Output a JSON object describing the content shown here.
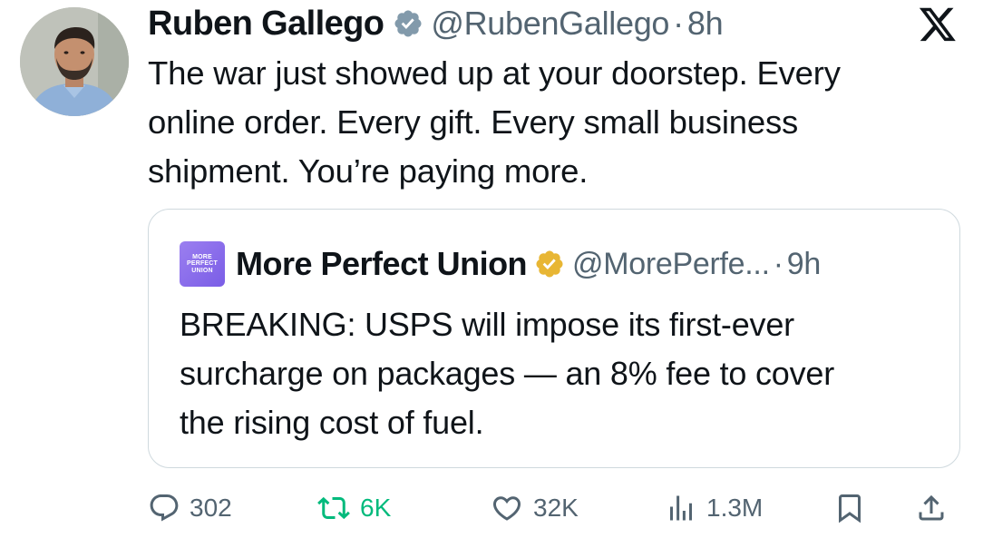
{
  "tweet": {
    "author": {
      "name": "Ruben Gallego",
      "handle": "@RubenGallego",
      "separator": "·",
      "time": "8h",
      "verified_color": "#829aab"
    },
    "text": "The war just showed up at your doorstep. Every\nonline order. Every gift. Every small business\nshipment. You’re paying more.",
    "platform_icon": "x-logo-icon"
  },
  "quote": {
    "author": {
      "avatar_text": "MORE\nPERFECT\nUNION",
      "name": "More Perfect Union",
      "handle": "@MorePerfe...",
      "separator": "·",
      "time": "9h",
      "verified_color": "#e8b634"
    },
    "text": "BREAKING: USPS will impose its first-ever\nsurcharge on packages — an 8% fee to cover\nthe rising cost of fuel."
  },
  "actions": {
    "reply": {
      "icon": "reply-icon",
      "count": "302"
    },
    "retweet": {
      "icon": "retweet-icon",
      "count": "6K",
      "color": "#00ba7c"
    },
    "like": {
      "icon": "heart-icon",
      "count": "32K"
    },
    "views": {
      "icon": "views-icon",
      "count": "1.3M"
    },
    "bookmark": {
      "icon": "bookmark-icon"
    },
    "share": {
      "icon": "share-icon"
    }
  }
}
